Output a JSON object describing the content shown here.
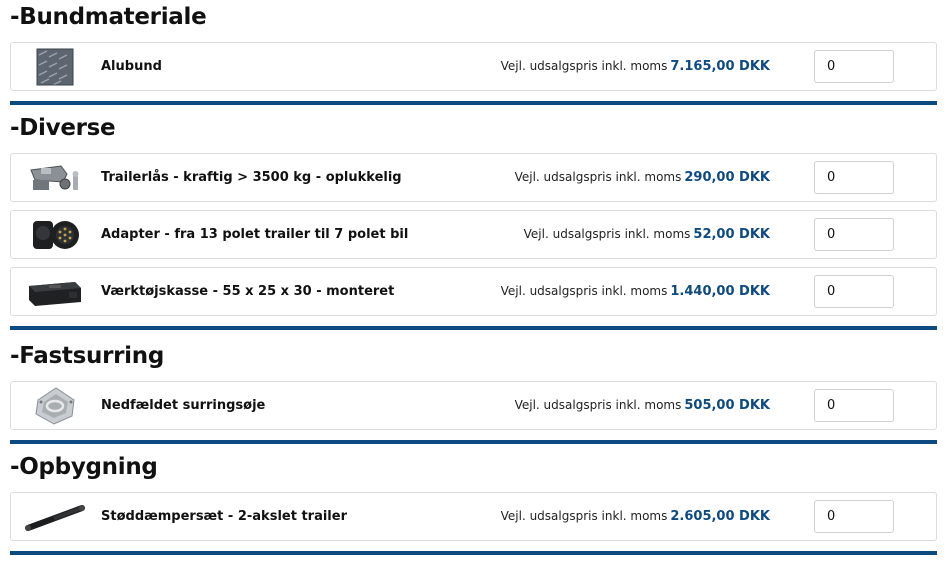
{
  "price_prefix": "Vejl. udsalgspris inkl. moms",
  "colors": {
    "accent": "#0d4a82",
    "divider": "#0d4a82"
  },
  "sections": [
    {
      "title": "-Bundmateriale",
      "items": [
        {
          "name": "Alubund",
          "price": "7.165,00 DKK",
          "qty": "0",
          "icon": "aluminum-floor-image"
        }
      ]
    },
    {
      "title": "-Diverse",
      "items": [
        {
          "name": "Trailerlås - kraftig > 3500 kg - oplukkelig",
          "price": "290,00 DKK",
          "qty": "0",
          "icon": "trailer-lock-image"
        },
        {
          "name": "Adapter - fra 13 polet trailer til 7 polet bil",
          "price": "52,00 DKK",
          "qty": "0",
          "icon": "plug-adapter-image"
        },
        {
          "name": "Værktøjskasse - 55 x 25 x 30 - monteret",
          "price": "1.440,00 DKK",
          "qty": "0",
          "icon": "toolbox-image"
        }
      ]
    },
    {
      "title": "-Fastsurring",
      "items": [
        {
          "name": "Nedfældet surringsøje",
          "price": "505,00 DKK",
          "qty": "0",
          "icon": "lashing-ring-image"
        }
      ]
    },
    {
      "title": "-Opbygning",
      "items": [
        {
          "name": "Støddæmpersæt - 2-akslet trailer",
          "price": "2.605,00 DKK",
          "qty": "0",
          "icon": "shock-absorber-image"
        }
      ]
    }
  ]
}
